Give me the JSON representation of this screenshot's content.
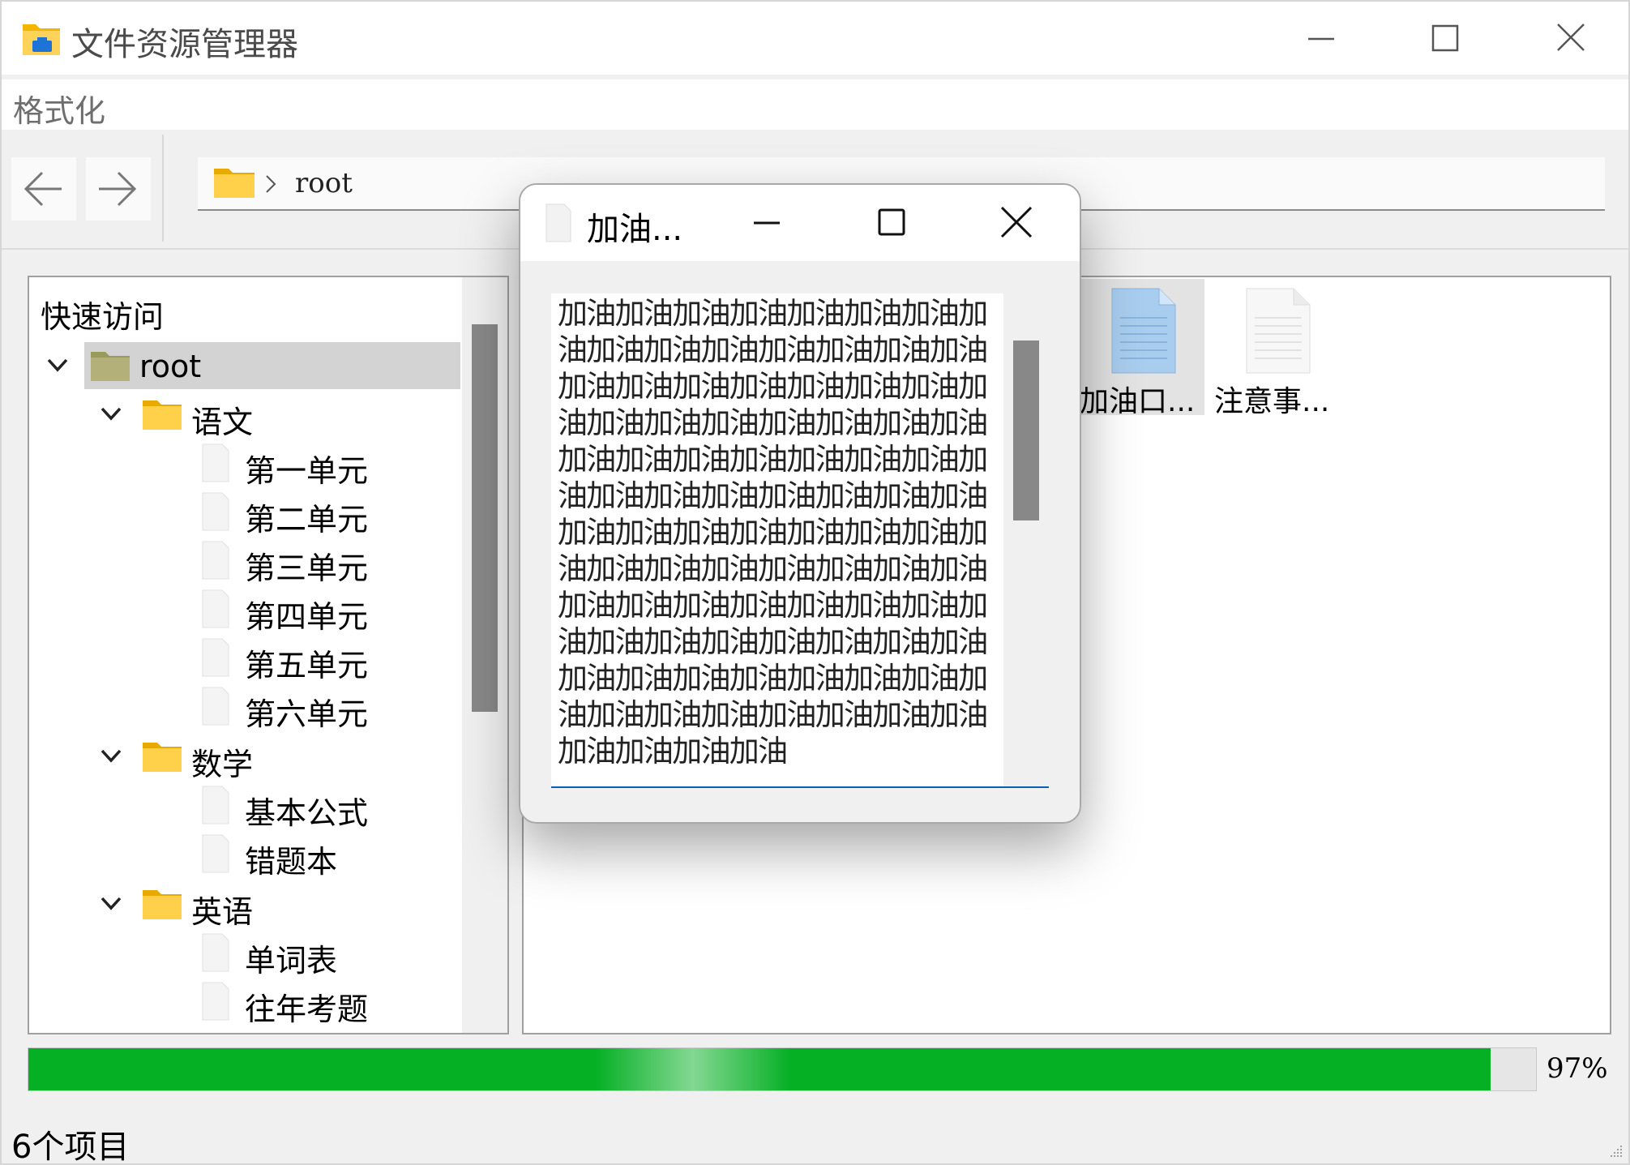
{
  "window": {
    "title": "文件资源管理器",
    "menu": [
      "格式化"
    ],
    "address_path": "root"
  },
  "tree": {
    "header": "快速访问",
    "root": "root",
    "folders": [
      {
        "label": "语文",
        "items": [
          "第一单元",
          "第二单元",
          "第三单元",
          "第四单元",
          "第五单元",
          "第六单元"
        ]
      },
      {
        "label": "数学",
        "items": [
          "基本公式",
          "错题本"
        ]
      },
      {
        "label": "英语",
        "items": [
          "单词表",
          "往年考题"
        ]
      }
    ]
  },
  "files": [
    {
      "name": "加油口...",
      "type": "blue-doc",
      "selected": true
    },
    {
      "name": "注意事...",
      "type": "white-doc",
      "selected": false
    }
  ],
  "dialog": {
    "title": "加油...",
    "content": "加油加油加油加油加油加油加油加油加油加油加油加油加油加油加油加油加油加油加油加油加油加油加油加油加油加油加油加油加油加油加油加油加油加油加油加油加油加油加油加油加油加油加油加油加油加油加油加油加油加油加油加油加油加油加油加油加油加油加油加油加油加油加油加油加油加油加油加油加油加油加油加油加油加油加油加油加油加油加油加油加油加油加油加油加油加油加油加油加油加油加油加油加油加油"
  },
  "progress": {
    "value": 97,
    "label": "97%"
  },
  "status": "6个项目",
  "colors": {
    "progress": "#06b025",
    "selection": "#d3d3d3",
    "accent": "#0a5fb4"
  }
}
